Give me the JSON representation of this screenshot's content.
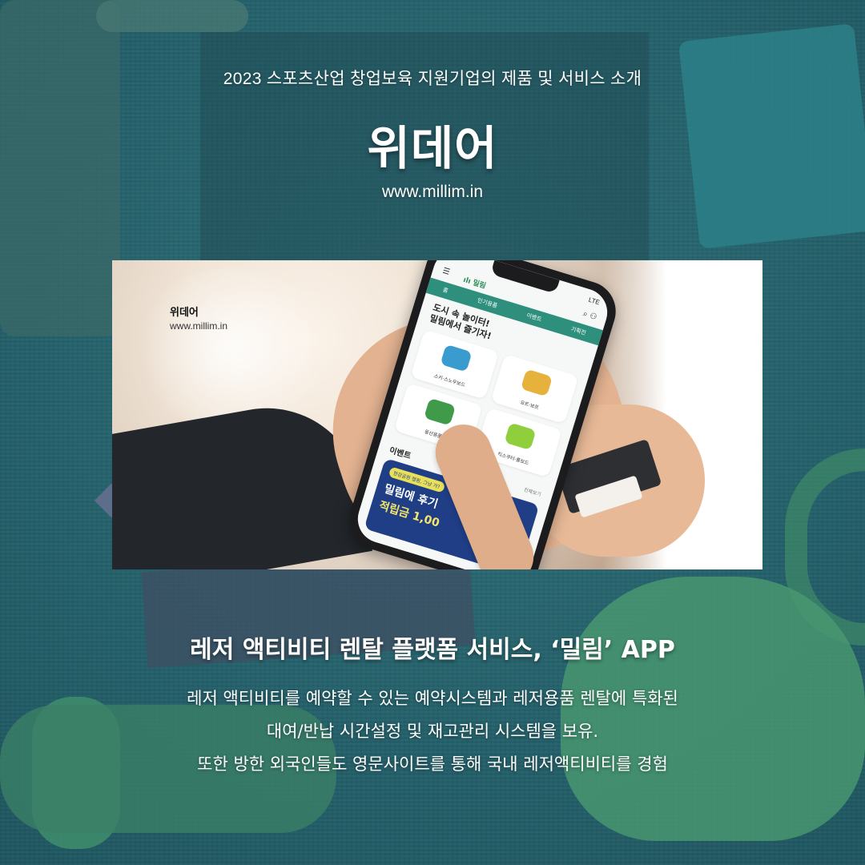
{
  "header": {
    "subtitle": "2023 스포츠산업 창업보육 지원기업의 제품 및 서비스 소개",
    "company_name": "위데어",
    "url": "www.millim.in"
  },
  "photo": {
    "overlay_company": "위데어",
    "overlay_url": "www.millim.in",
    "phone": {
      "app_logo": "ılı 밀림",
      "status_right": "LTE",
      "tabs": [
        "홈",
        "인기용품",
        "이벤트",
        "기획전"
      ],
      "banner_line1": "도시 속 놀이터!",
      "banner_line2": "밀림에서 즐기자!",
      "categories": [
        "스키·스노우보드",
        "요트·보트",
        "등산용품",
        "킥스쿠터·롤보드"
      ],
      "events_label": "이벤트",
      "events_more": "전체보기",
      "promo_pill": "한강공원 캠핑, 그냥 가?",
      "promo_line1": "밀림에 후기",
      "promo_line2": "적립금 1,00"
    }
  },
  "service": {
    "title": "레저 액티비티 렌탈 플랫폼 서비스, ‘밀림’ APP",
    "description": [
      "레저 액티비티를 예약할 수 있는 예약시스템과 레저용품 렌탈에 특화된",
      "대여/반납 시간설정 및 재고관리 시스템을 보유.",
      "또한 방한 외국인들도 영문사이트를 통해 국내 레저액티비티를 경험"
    ]
  },
  "colors": {
    "background": "#2a6870",
    "text": "#ffffff",
    "app_accent": "#2e8f7d",
    "promo_bg": "#1f3e86"
  }
}
